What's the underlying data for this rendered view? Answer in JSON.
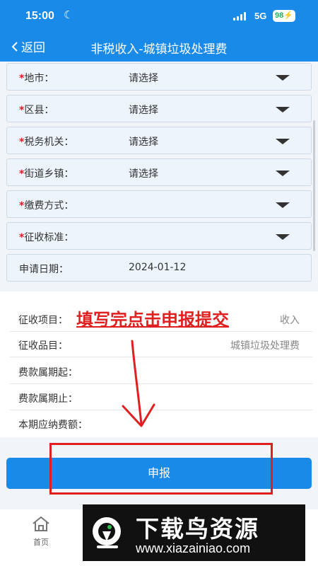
{
  "status_bar": {
    "time": "15:00",
    "network": "5G",
    "battery": "98"
  },
  "nav": {
    "back_label": "返回",
    "title": "非税收入-城镇垃圾处理费"
  },
  "form": {
    "rows": [
      {
        "label": "地市：",
        "value": "请选择",
        "required": true
      },
      {
        "label": "区县：",
        "value": "请选择",
        "required": true
      },
      {
        "label": "税务机关：",
        "value": "请选择",
        "required": true
      },
      {
        "label": "街道乡镇：",
        "value": "请选择",
        "required": true
      },
      {
        "label": "缴费方式：",
        "value": "",
        "required": true
      },
      {
        "label": "征收标准：",
        "value": "",
        "required": true
      },
      {
        "label": "申请日期：",
        "value": "2024-01-12",
        "required": false
      }
    ],
    "required_mark": "*"
  },
  "info": {
    "rows": [
      {
        "label": "征收项目：",
        "value": "收入"
      },
      {
        "label": "征收品目：",
        "value": "城镇垃圾处理费"
      },
      {
        "label": "费款属期起：",
        "value": ""
      },
      {
        "label": "费款属期止：",
        "value": ""
      },
      {
        "label": "本期应纳费额：",
        "value": ""
      }
    ]
  },
  "annotation": "填写完点击申报提交",
  "submit_label": "申报",
  "tabbar": {
    "home_label": "首页"
  },
  "watermark": {
    "title": "下载鸟资源",
    "url": "www.xiazainiao.com"
  },
  "colors": {
    "primary": "#1a8ae8",
    "required": "#e02020",
    "annotation": "#e02020"
  }
}
